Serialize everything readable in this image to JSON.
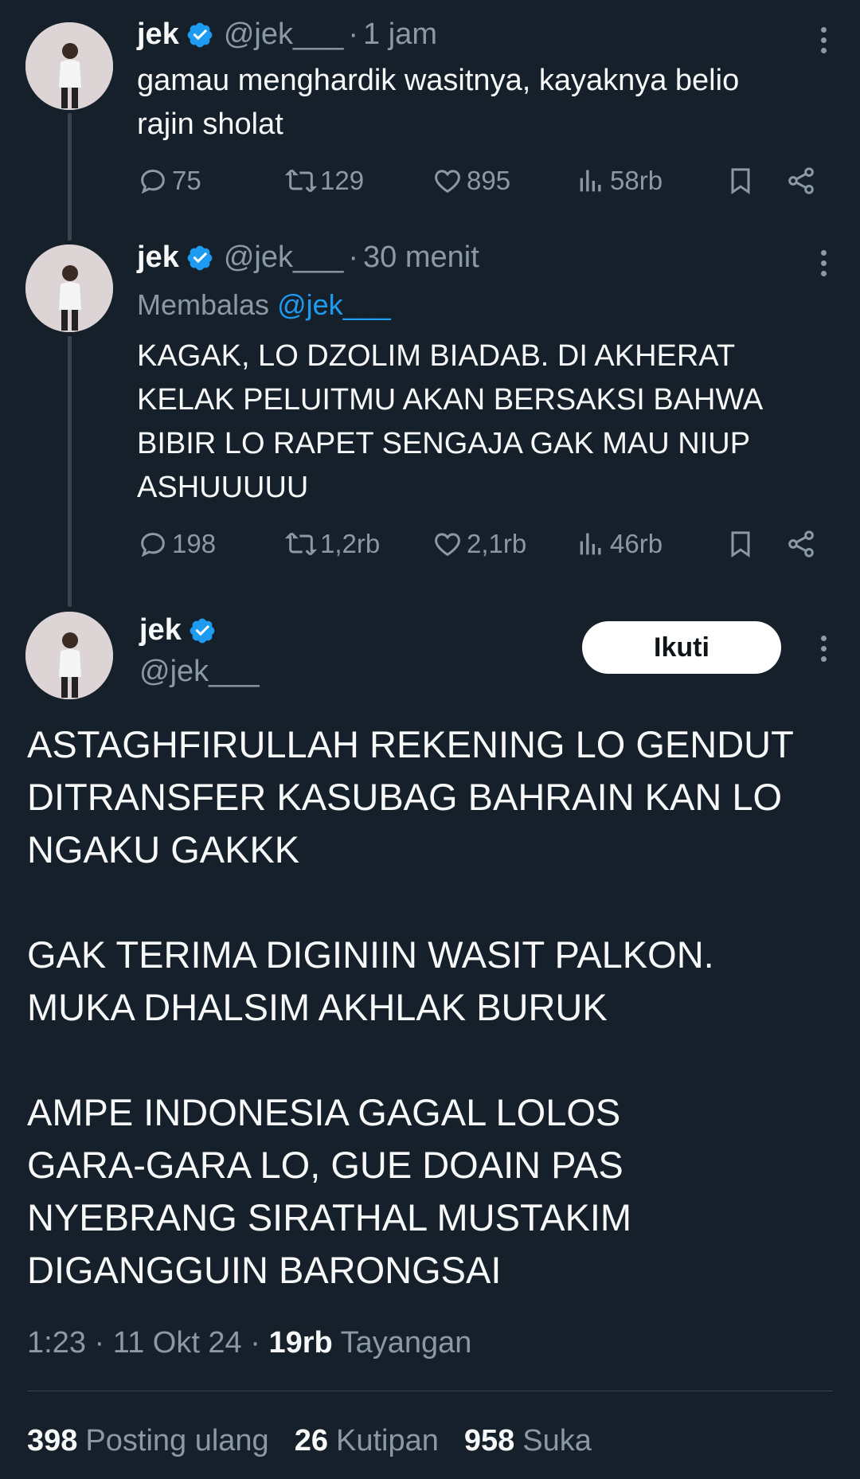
{
  "tweets": [
    {
      "name": "jek",
      "handle": "@jek___",
      "separator": "·",
      "time": "1 jam",
      "text": "gamau menghardik wasitnya, kayaknya belio\nrajin sholat",
      "replies": "75",
      "reposts": "129",
      "likes": "895",
      "views": "58rb"
    },
    {
      "name": "jek",
      "handle": "@jek___",
      "separator": "·",
      "time": "30 menit",
      "replying_prefix": "Membalas",
      "replying_to": "@jek___",
      "text": "KAGAK, LO DZOLIM BIADAB. DI AKHERAT\nKELAK PELUITMU AKAN BERSAKSI BAHWA\nBIBIR LO RAPET SENGAJA GAK MAU NIUP\nASHUUUUU",
      "replies": "198",
      "reposts": "1,2rb",
      "likes": "2,1rb",
      "views": "46rb"
    }
  ],
  "main": {
    "name": "jek",
    "handle": "@jek___",
    "follow_label": "Ikuti",
    "text": "ASTAGHFIRULLAH REKENING LO GENDUT\nDITRANSFER KASUBAG BAHRAIN KAN LO\nNGAKU GAKKK\n\nGAK TERIMA DIGINIIN WASIT PALKON.\nMUKA DHALSIM AKHLAK BURUK\n\nAMPE INDONESIA GAGAL LOLOS\nGARA-GARA LO, GUE DOAIN PAS\nNYEBRANG SIRATHAL MUSTAKIM\nDIGANGGUIN BARONGSAI",
    "time": "1:23",
    "date": "11 Okt 24",
    "separator": "·",
    "views_count": "19rb",
    "views_label": "Tayangan",
    "reposts_count": "398",
    "reposts_label": "Posting ulang",
    "quotes_count": "26",
    "quotes_label": "Kutipan",
    "likes_count": "958",
    "likes_label": "Suka"
  },
  "colors": {
    "background": "#15202b",
    "text": "#f7f9f9",
    "secondary": "#8b98a5",
    "accent": "#1d9bf0"
  },
  "icons": [
    "verified-badge-icon",
    "more-icon",
    "reply-icon",
    "repost-icon",
    "like-icon",
    "views-icon",
    "bookmark-icon",
    "share-icon"
  ]
}
